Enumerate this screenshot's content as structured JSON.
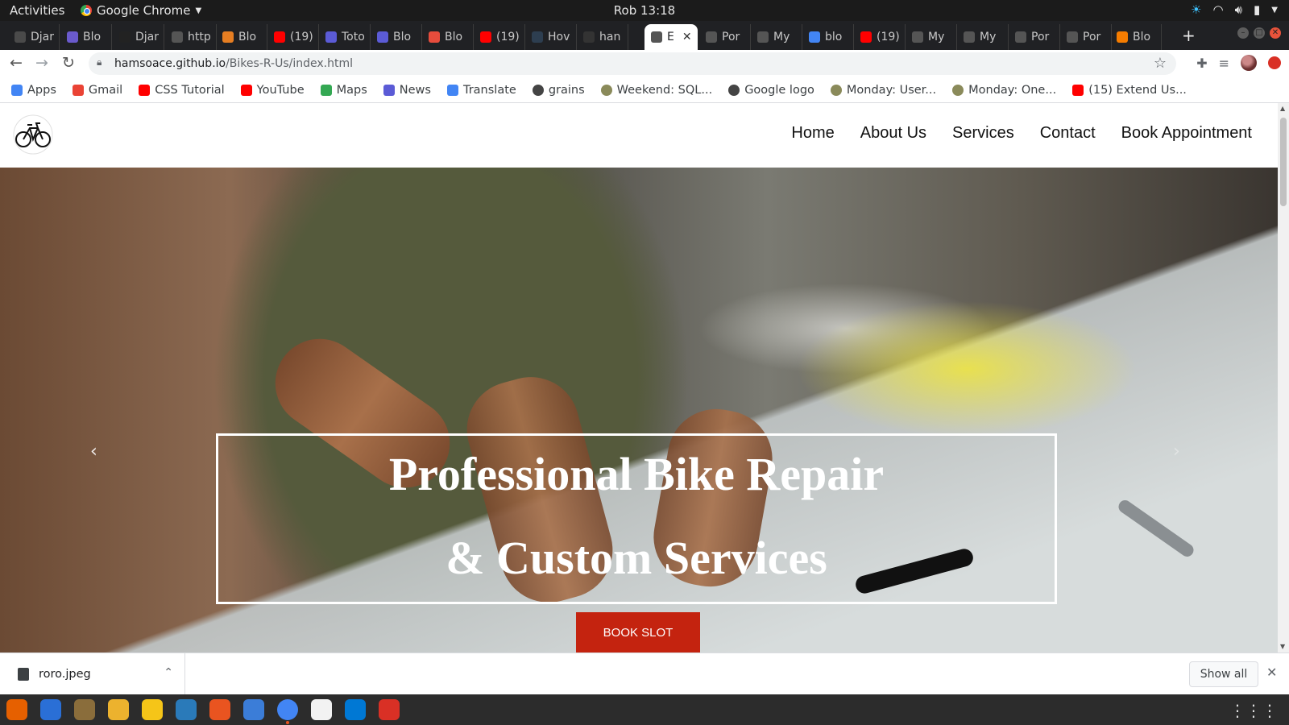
{
  "system": {
    "activities": "Activities",
    "app_name": "Google Chrome",
    "clock": "Rob 13:18"
  },
  "tabs": [
    {
      "label": "Djar",
      "favicon_color": "#4a4a4a"
    },
    {
      "label": "Blo",
      "favicon_color": "#6a5acd"
    },
    {
      "label": "Djar",
      "favicon_color": "#222222"
    },
    {
      "label": "http",
      "favicon_color": "#555555"
    },
    {
      "label": "Blo",
      "favicon_color": "#e67e22"
    },
    {
      "label": "(19)",
      "favicon_color": "#ff0000"
    },
    {
      "label": "Toto",
      "favicon_color": "#5b5bd6"
    },
    {
      "label": "Blo",
      "favicon_color": "#5b5bd6"
    },
    {
      "label": "Blo",
      "favicon_color": "#e74c3c"
    },
    {
      "label": "(19)",
      "favicon_color": "#ff0000"
    },
    {
      "label": "Hov",
      "favicon_color": "#2d3e50"
    },
    {
      "label": "han",
      "favicon_color": "#333333"
    },
    {
      "label": "E",
      "favicon_color": "#555555",
      "active": true
    },
    {
      "label": "Por",
      "favicon_color": "#555555"
    },
    {
      "label": "My",
      "favicon_color": "#555555"
    },
    {
      "label": "blo",
      "favicon_color": "#4285f4"
    },
    {
      "label": "(19)",
      "favicon_color": "#ff0000"
    },
    {
      "label": "My",
      "favicon_color": "#555555"
    },
    {
      "label": "My",
      "favicon_color": "#555555"
    },
    {
      "label": "Por",
      "favicon_color": "#555555"
    },
    {
      "label": "Por",
      "favicon_color": "#555555"
    },
    {
      "label": "Blo",
      "favicon_color": "#f57c00"
    }
  ],
  "toolbar": {
    "url_host": "hamsoace.github.io",
    "url_path": "/Bikes-R-Us/index.html"
  },
  "bookmarks": [
    {
      "label": "Apps",
      "icon": "apps-grid-icon",
      "color": "#4285f4"
    },
    {
      "label": "Gmail",
      "icon": "gmail-icon",
      "color": "#ea4335"
    },
    {
      "label": "CSS Tutorial",
      "icon": "youtube-icon",
      "color": "#ff0000"
    },
    {
      "label": "YouTube",
      "icon": "youtube-icon",
      "color": "#ff0000"
    },
    {
      "label": "Maps",
      "icon": "maps-icon",
      "color": "#34a853"
    },
    {
      "label": "News",
      "icon": "news-icon",
      "color": "#5b5bd6"
    },
    {
      "label": "Translate",
      "icon": "translate-icon",
      "color": "#4285f4"
    },
    {
      "label": "grains",
      "icon": "globe-icon",
      "color": "#444444"
    },
    {
      "label": "Weekend: SQL...",
      "icon": "sprout-icon",
      "color": "#8a8a5a"
    },
    {
      "label": "Google logo",
      "icon": "globe-icon",
      "color": "#444444"
    },
    {
      "label": "Monday: User...",
      "icon": "sprout-icon",
      "color": "#8a8a5a"
    },
    {
      "label": "Monday: One...",
      "icon": "sprout-icon",
      "color": "#8a8a5a"
    },
    {
      "label": "(15) Extend Us...",
      "icon": "youtube-icon",
      "color": "#ff0000"
    }
  ],
  "site": {
    "nav": [
      "Home",
      "About Us",
      "Services",
      "Contact",
      "Book Appointment"
    ],
    "hero_line1": "Professional Bike Repair",
    "hero_line2": "& Custom Services",
    "cta": "BOOK SLOT"
  },
  "shelf": {
    "filename": "roro.jpeg",
    "show_all": "Show all"
  },
  "dock_apps": [
    {
      "name": "firefox",
      "color": "#e66000"
    },
    {
      "name": "thunderbird",
      "color": "#2a6fd6"
    },
    {
      "name": "files",
      "color": "#8a6d3b"
    },
    {
      "name": "slack",
      "color": "#ecb22e"
    },
    {
      "name": "rhythmbox",
      "color": "#f5c518"
    },
    {
      "name": "libreoffice-writer",
      "color": "#2a7ab9"
    },
    {
      "name": "software",
      "color": "#e95420"
    },
    {
      "name": "help",
      "color": "#3b7dd8"
    },
    {
      "name": "chrome",
      "color": "#4285f4"
    },
    {
      "name": "text-editor",
      "color": "#f2f2f2"
    },
    {
      "name": "vscode",
      "color": "#0078d4"
    },
    {
      "name": "screenshot",
      "color": "#d93025"
    }
  ]
}
